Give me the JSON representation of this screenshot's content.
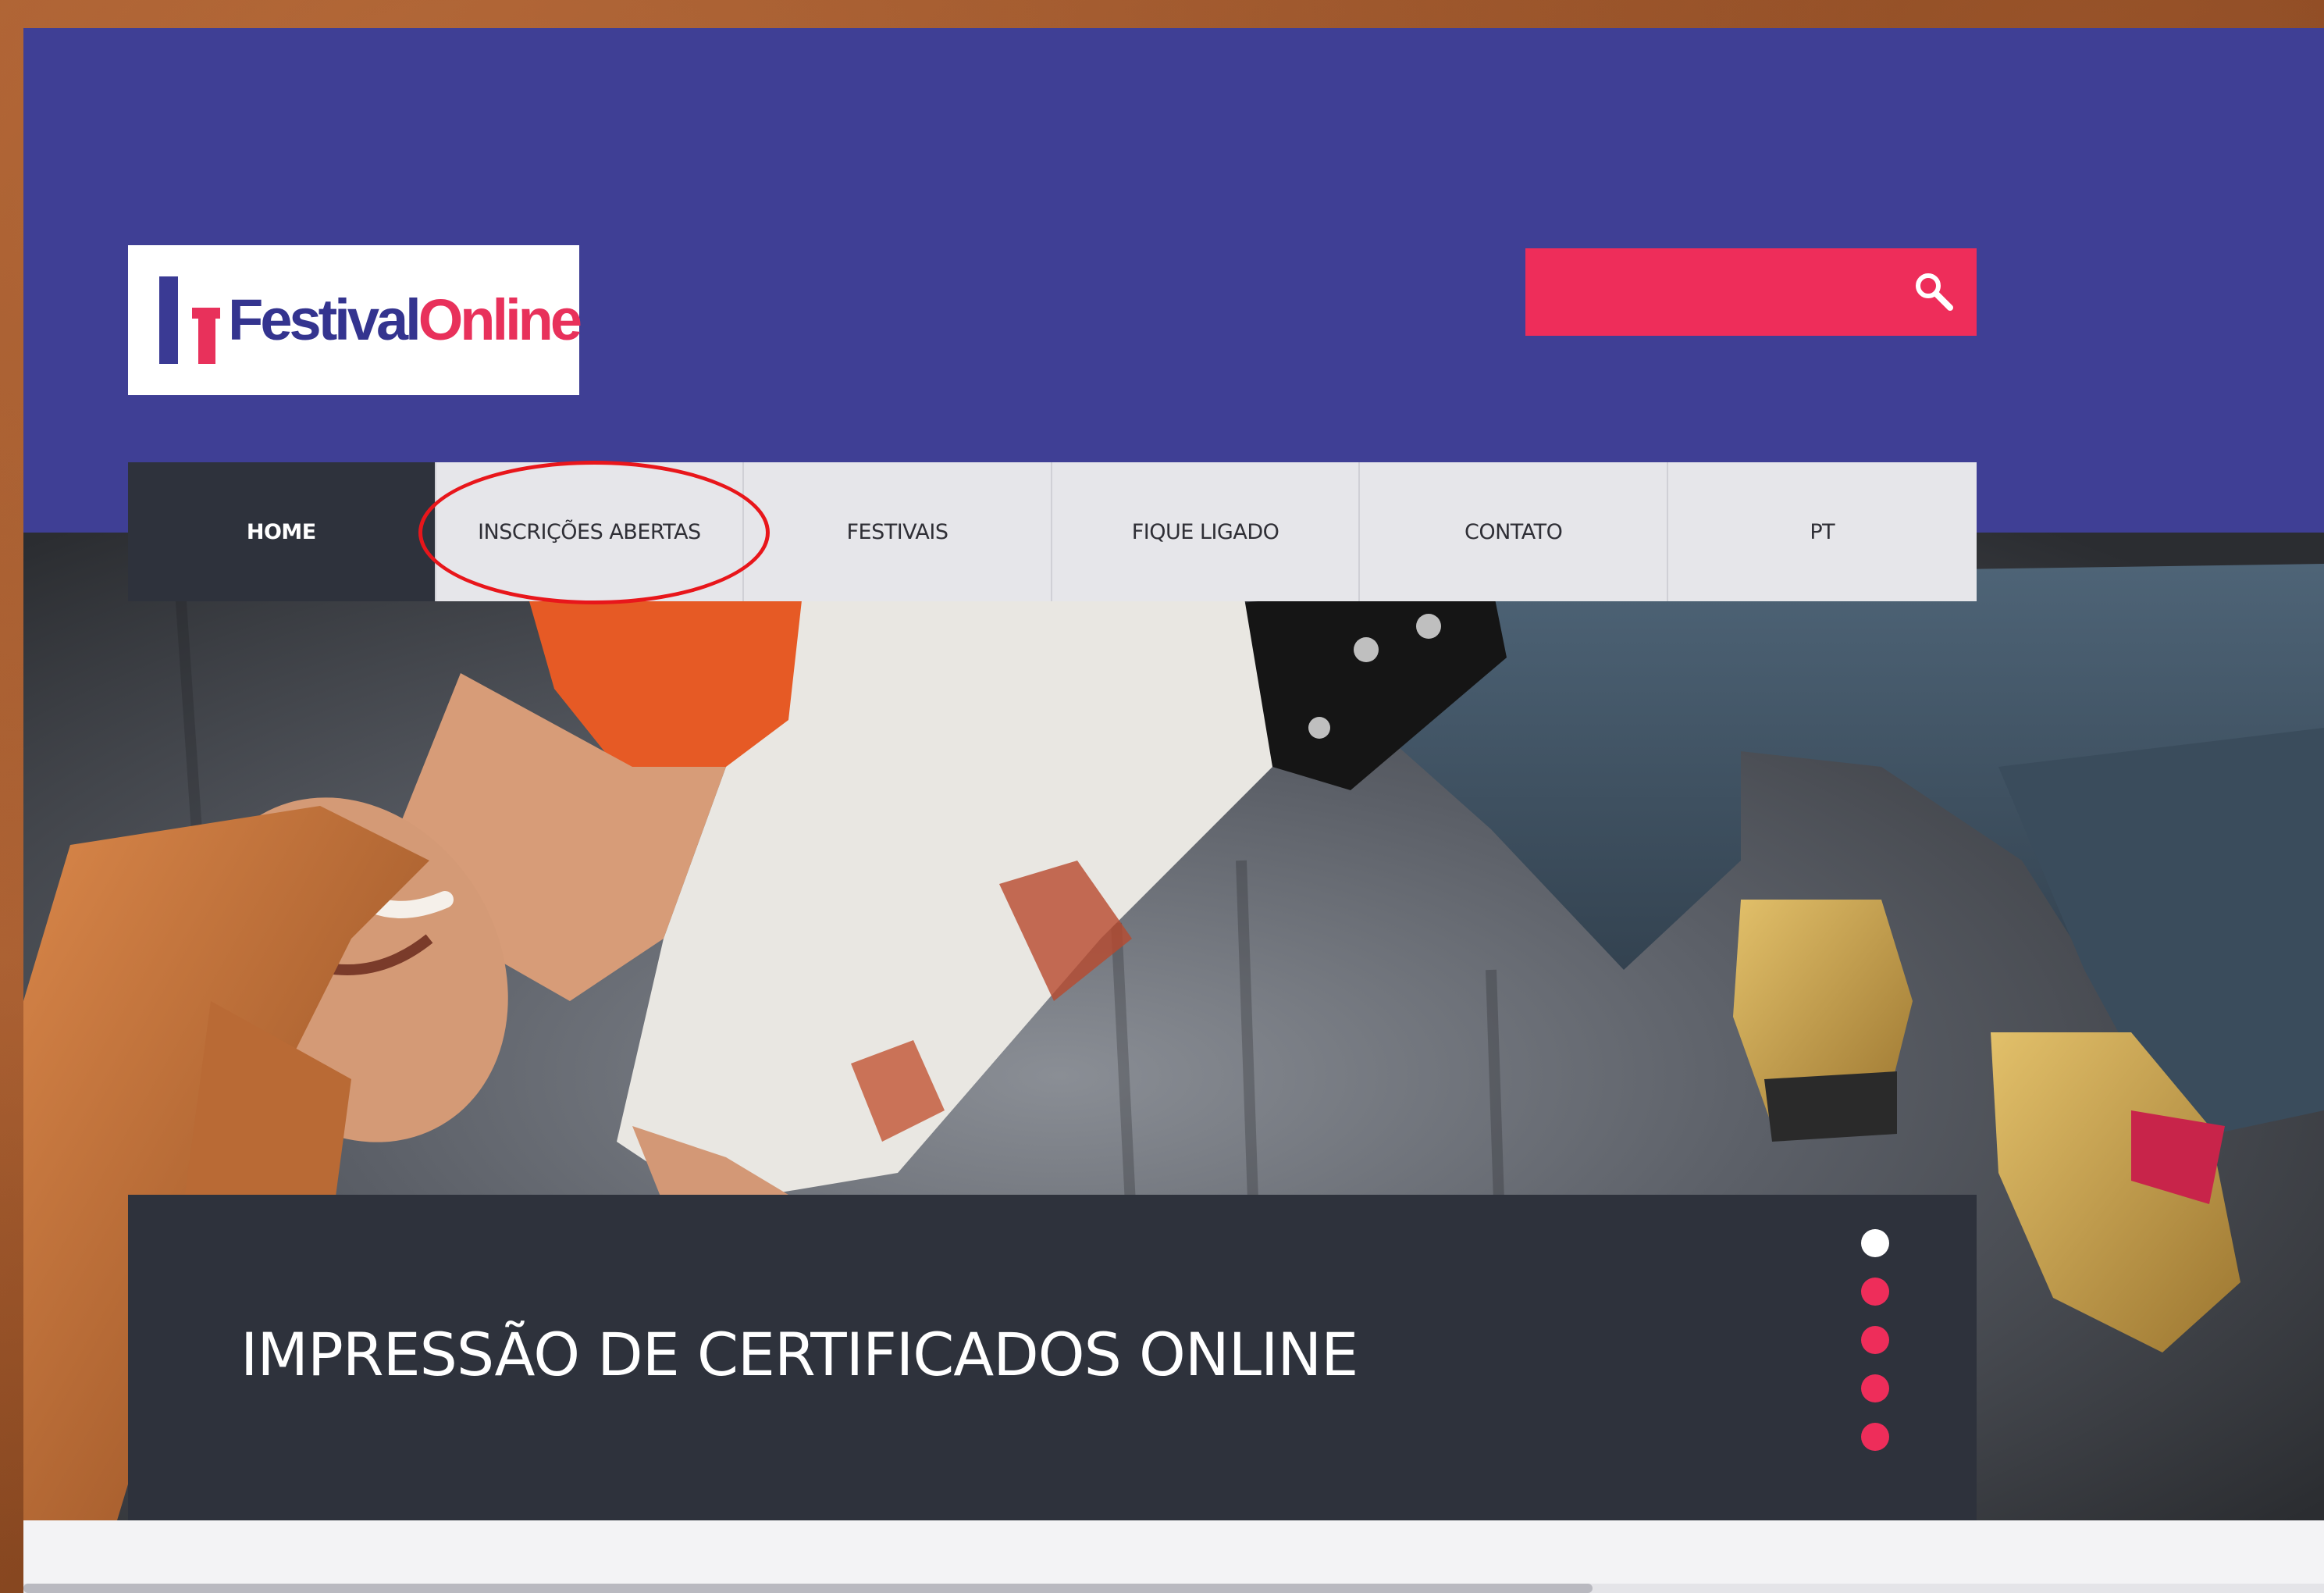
{
  "colors": {
    "header_bg": "#3f3f95",
    "accent_pink": "#ee2d5a",
    "nav_active_bg": "#2e323c",
    "nav_bg": "#e6e6ea",
    "caption_bg": "#2e323c",
    "annotation_red": "#e8161b"
  },
  "logo": {
    "text_part1": "Festival",
    "text_part2": "Online"
  },
  "search": {
    "value": "",
    "placeholder": "",
    "icon": "search-icon"
  },
  "nav": {
    "items": [
      {
        "label": "HOME",
        "active": true
      },
      {
        "label": "INSCRIÇÕES ABERTAS",
        "active": false
      },
      {
        "label": "FESTIVAIS",
        "active": false
      },
      {
        "label": "FIQUE LIGADO",
        "active": false
      },
      {
        "label": "CONTATO",
        "active": false
      },
      {
        "label": "PT",
        "active": false
      }
    ]
  },
  "slider": {
    "caption": "IMPRESSÃO DE CERTIFICADOS ONLINE",
    "dots_count": 5,
    "active_dot": 1
  }
}
